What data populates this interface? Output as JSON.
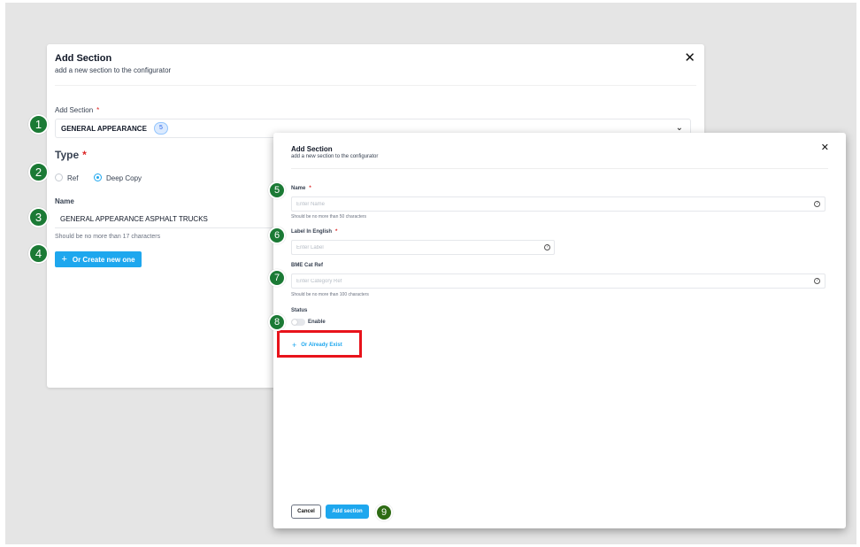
{
  "back_dialog": {
    "title": "Add Section",
    "subtitle": "add a new section to the configurator",
    "section_label": "Add Section",
    "required_mark": "*",
    "section_value": "GENERAL APPEARANCE",
    "section_count": "5",
    "type_label": "Type",
    "radio_ref": "Ref",
    "radio_deep_copy": "Deep Copy",
    "selected_type": "Deep Copy",
    "name_label": "Name",
    "name_value": "GENERAL APPEARANCE ASPHALT TRUCKS",
    "name_hint": "Should be no more than 17 characters",
    "create_button": "Or Create new one"
  },
  "front_dialog": {
    "title": "Add Section",
    "subtitle": "add a new section to the configurator",
    "name_label": "Name",
    "name_placeholder": "Enter Name",
    "name_hint": "Should be no more than 50 characters",
    "label_english_label": "Label In English",
    "label_placeholder": "Enter Label",
    "bme_label": "BME Cat Ref",
    "bme_placeholder": "Enter Category Ref",
    "bme_hint": "Should be no more than 100 characters",
    "status_label": "Status",
    "status_toggle_label": "Enable",
    "status_enabled": false,
    "already_exist_button": "Or Already Exist",
    "cancel_button": "Cancel",
    "add_button": "Add section"
  },
  "markers": [
    "1",
    "2",
    "3",
    "4",
    "5",
    "6",
    "7",
    "8",
    "9"
  ],
  "icons": {
    "close": "close-icon",
    "chevron": "chevron-down-icon",
    "help": "help-circle-icon",
    "plus": "plus-icon"
  },
  "colors": {
    "accent": "#1ea7ee",
    "marker": "#1b7a35",
    "highlight": "#e8131b",
    "required": "#dc2626"
  }
}
